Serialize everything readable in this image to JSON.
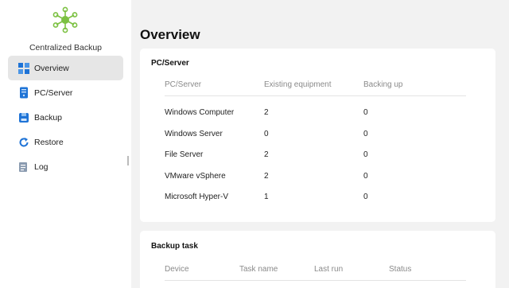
{
  "window": {
    "minimize_icon": "minimize-icon",
    "maximize_icon": "maximize-icon",
    "close_icon": "close-icon",
    "minimize_glyph": "–",
    "maximize_glyph": "□",
    "close_glyph": "✕"
  },
  "sidebar": {
    "app_title": "Centralized Backup",
    "logo_color": "#7cc142",
    "items": [
      {
        "label": "Overview",
        "icon": "overview-icon",
        "active": true
      },
      {
        "label": "PC/Server",
        "icon": "pc-server-icon",
        "active": false
      },
      {
        "label": "Backup",
        "icon": "backup-icon",
        "active": false
      },
      {
        "label": "Restore",
        "icon": "restore-icon",
        "active": false
      },
      {
        "label": "Log",
        "icon": "log-icon",
        "active": false
      }
    ]
  },
  "main": {
    "title": "Overview",
    "pc_server": {
      "title": "PC/Server",
      "columns": [
        "PC/Server",
        "Existing equipment",
        "Backing up"
      ],
      "rows": [
        {
          "name": "Windows Computer",
          "existing": "2",
          "backing": "0"
        },
        {
          "name": "Windows Server",
          "existing": "0",
          "backing": "0"
        },
        {
          "name": "File Server",
          "existing": "2",
          "backing": "0"
        },
        {
          "name": "VMware vSphere",
          "existing": "2",
          "backing": "0"
        },
        {
          "name": "Microsoft Hyper-V",
          "existing": "1",
          "backing": "0"
        }
      ]
    },
    "backup_task": {
      "title": "Backup task",
      "columns": [
        "Device",
        "Task name",
        "Last run",
        "Status"
      ]
    }
  },
  "colors": {
    "accent": "#1e73d6",
    "logo": "#7cc142",
    "main_bg": "#f2f2f2",
    "active_item_bg": "#e6e6e6"
  }
}
